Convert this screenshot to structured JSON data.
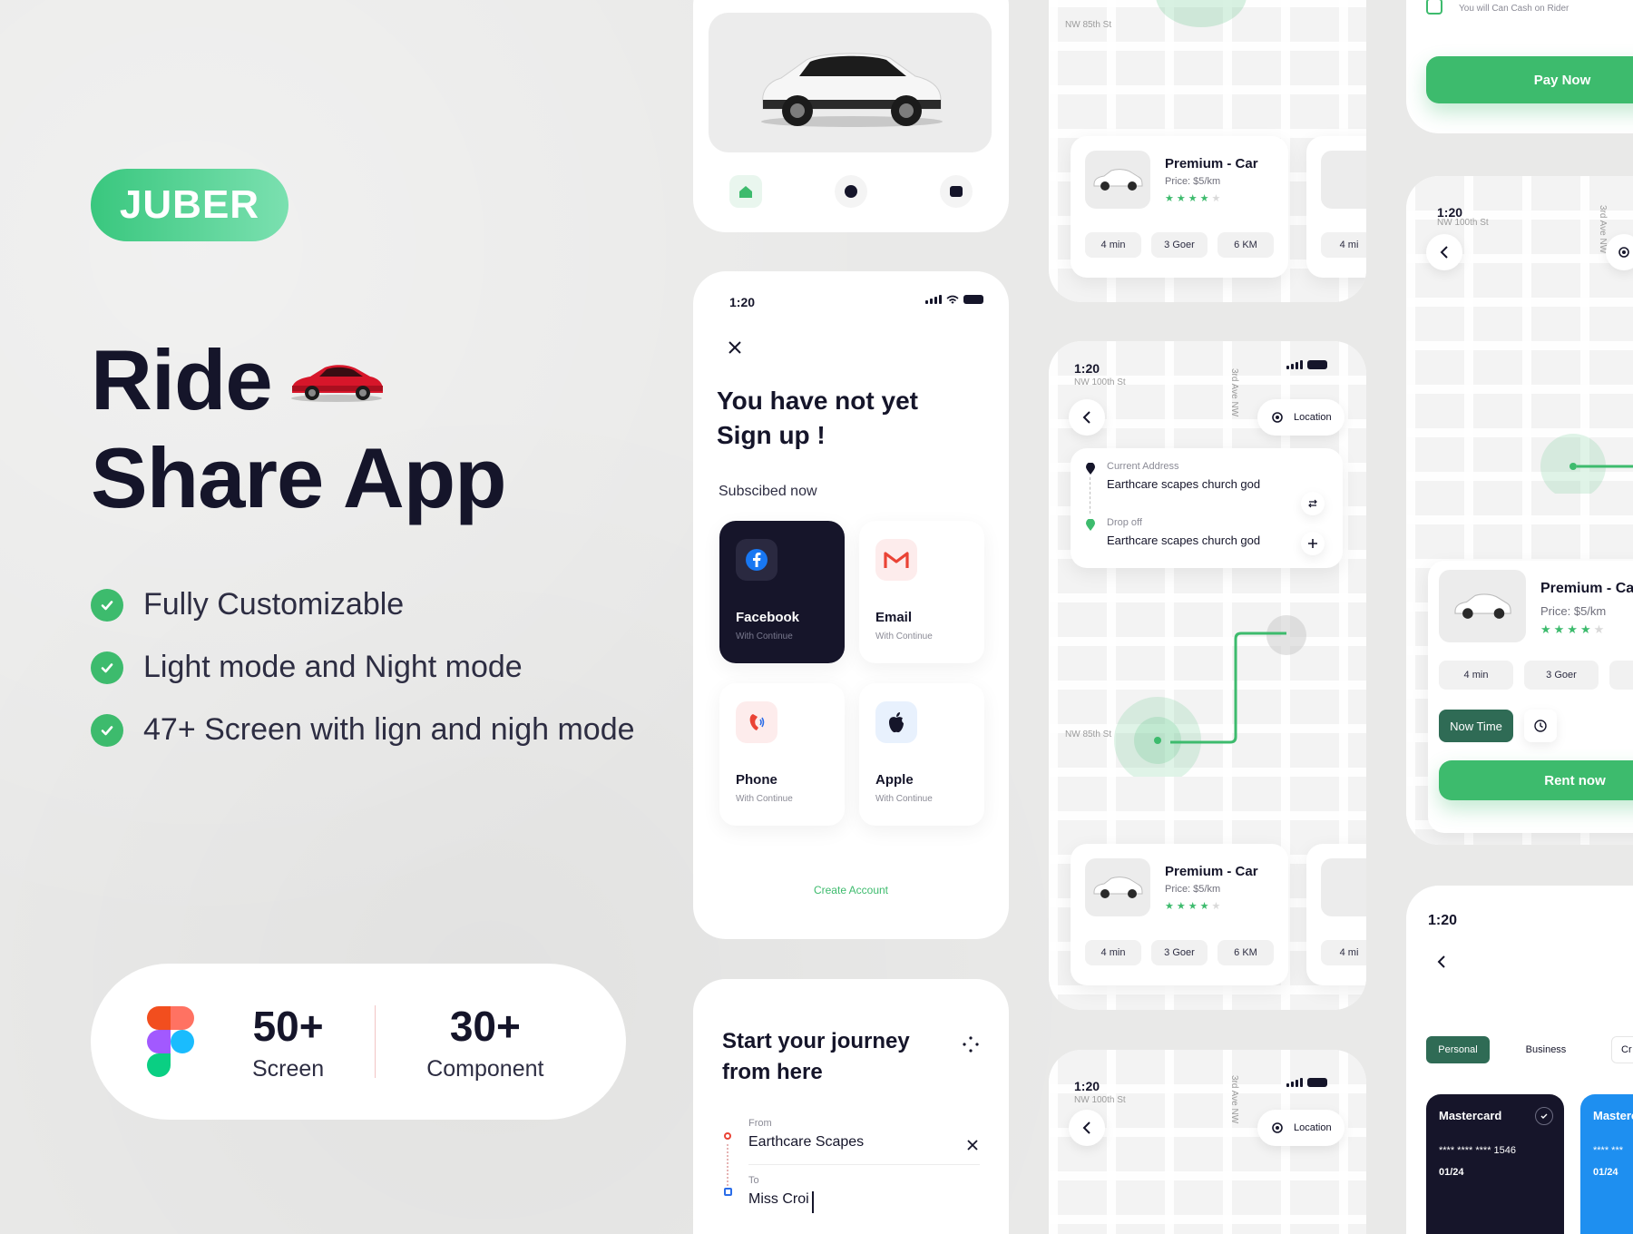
{
  "hero": {
    "brand": "JUBER",
    "title_line1": "Ride",
    "title_line2": "Share App",
    "features": [
      "Fully Customizable",
      "Light mode and Night mode",
      "47+ Screen with lign and nigh mode"
    ],
    "stats": [
      {
        "value": "50+",
        "label": "Screen"
      },
      {
        "value": "30+",
        "label": "Component"
      }
    ]
  },
  "colors": {
    "accent": "#3dbb6d",
    "dark": "#16152a",
    "background": "#e9e9e8"
  },
  "signup": {
    "time": "1:20",
    "title_line1": "You have not yet",
    "title_line2": "Sign up !",
    "subtitle": "Subscibed now",
    "options": [
      {
        "title": "Facebook",
        "sub": "With Continue",
        "icon": "facebook-icon"
      },
      {
        "title": "Email",
        "sub": "With Continue",
        "icon": "gmail-icon"
      },
      {
        "title": "Phone",
        "sub": "With Continue",
        "icon": "phone-icon"
      },
      {
        "title": "Apple",
        "sub": "With Continue",
        "icon": "apple-icon"
      }
    ],
    "create_account": "Create Account"
  },
  "journey": {
    "title_line1": "Start your journey",
    "title_line2": "from here",
    "from_label": "From",
    "from_value": "Earthcare Scapes",
    "to_label": "To",
    "to_value": "Miss Croi"
  },
  "ride_top": {
    "street": "NW 85th St",
    "car_name": "Premium - Car",
    "price": "Price:  $5/km",
    "chips": [
      "4 min",
      "3 Goer",
      "6 KM"
    ],
    "chip_peek": "4 mi"
  },
  "route": {
    "time": "1:20",
    "street_top": "NW 100th St",
    "street_side": "3rd Ave NW",
    "street_mid": "NW 85th St",
    "location_label": "Location",
    "current_label": "Current Address",
    "current_value": "Earthcare scapes church god",
    "drop_label": "Drop off",
    "drop_value": "Earthcare scapes church god",
    "car_name": "Premium - Car",
    "price": "Price:  $5/km",
    "chips": [
      "4 min",
      "3 Goer",
      "6 KM"
    ],
    "chip_peek": "4 mi"
  },
  "map_bottom": {
    "time": "1:20",
    "street_top": "NW 100th St",
    "street_side": "3rd Ave NW",
    "location_label": "Location"
  },
  "pay": {
    "note": "You will Can Cash on Rider",
    "button": "Pay Now"
  },
  "rent": {
    "time": "1:20",
    "street_top": "NW 100th St",
    "street_side": "3rd Ave NW",
    "car_name": "Premium - Ca",
    "price": "Price:  $5/km",
    "chips": [
      "4 min",
      "3 Goer"
    ],
    "now_time": "Now Time",
    "button": "Rent now"
  },
  "cards": {
    "time": "1:20",
    "tabs": [
      "Personal",
      "Business",
      "Cr"
    ],
    "card1_name": "Mastercard",
    "card1_number": "**** **** **** 1546",
    "card1_exp": "01/24",
    "card2_name": "Masterc",
    "card2_number": "**** ***",
    "card2_exp": "01/24"
  }
}
